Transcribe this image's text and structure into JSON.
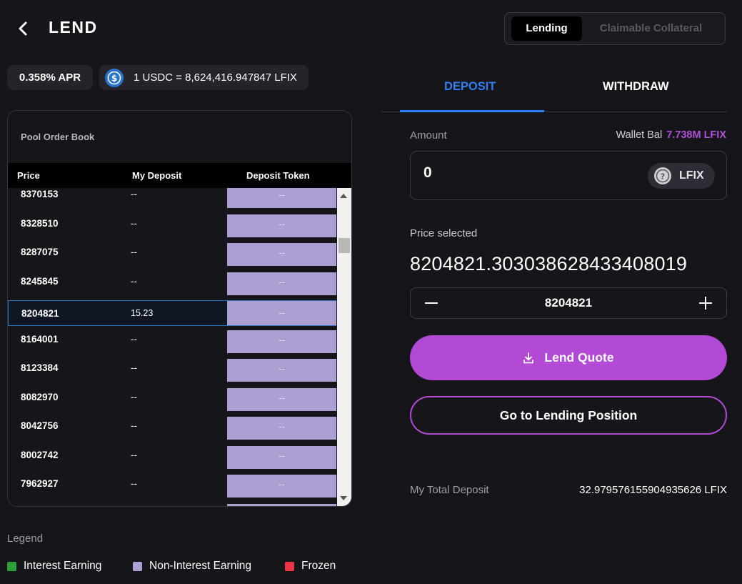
{
  "header": {
    "title": "LEND"
  },
  "mode_toggle": {
    "active": "Lending",
    "inactive": "Claimable Collateral"
  },
  "info": {
    "apr": "0.358% APR",
    "rate": "1 USDC = 8,624,416.947847 LFIX"
  },
  "order_book": {
    "title": "Pool Order Book",
    "columns": [
      "Price",
      "My Deposit",
      "Deposit Token"
    ],
    "rows": [
      {
        "price": "8370153",
        "my_deposit": "--",
        "token": "--"
      },
      {
        "price": "8328510",
        "my_deposit": "--",
        "token": "--"
      },
      {
        "price": "8287075",
        "my_deposit": "--",
        "token": "--"
      },
      {
        "price": "8245845",
        "my_deposit": "--",
        "token": "--"
      },
      {
        "price": "8204821",
        "my_deposit": "15.23",
        "token": "--"
      },
      {
        "price": "8164001",
        "my_deposit": "--",
        "token": "--"
      },
      {
        "price": "8123384",
        "my_deposit": "--",
        "token": "--"
      },
      {
        "price": "8082970",
        "my_deposit": "--",
        "token": "--"
      },
      {
        "price": "8042756",
        "my_deposit": "--",
        "token": "--"
      },
      {
        "price": "8002742",
        "my_deposit": "--",
        "token": "--"
      },
      {
        "price": "7962927",
        "my_deposit": "--",
        "token": "--"
      },
      {
        "price": "",
        "my_deposit": "",
        "token": ""
      }
    ]
  },
  "legend": {
    "title": "Legend",
    "items": [
      {
        "label": "Interest Earning",
        "color": "#2e9e3d"
      },
      {
        "label": "Non-Interest Earning",
        "color": "#ad9fd1"
      },
      {
        "label": "Frozen",
        "color": "#ee3345"
      }
    ]
  },
  "tabs": {
    "deposit": "DEPOSIT",
    "withdraw": "WITHDRAW"
  },
  "amount": {
    "label": "Amount",
    "wallet_label": "Wallet Bal",
    "wallet_value": "7.738M LFIX",
    "value": "0",
    "token": "LFIX"
  },
  "price": {
    "label": "Price selected",
    "value": "8204821.303038628433408019",
    "stepper_value": "8204821"
  },
  "buttons": {
    "lend": "Lend Quote",
    "goto": "Go to Lending Position"
  },
  "total": {
    "label": "My Total Deposit",
    "value": "32.979576155904935626 LFIX"
  },
  "colors": {
    "accent": "#b24ad6",
    "tab_active": "#2f7ff7",
    "non_interest": "#ad9fd1",
    "selected_border": "#2f74c0"
  },
  "icons": {
    "back": "chevron-left-icon",
    "usdc": "usdc-icon",
    "token": "question-circle-icon",
    "download": "download-icon",
    "minus": "minus-icon",
    "plus": "plus-icon"
  }
}
